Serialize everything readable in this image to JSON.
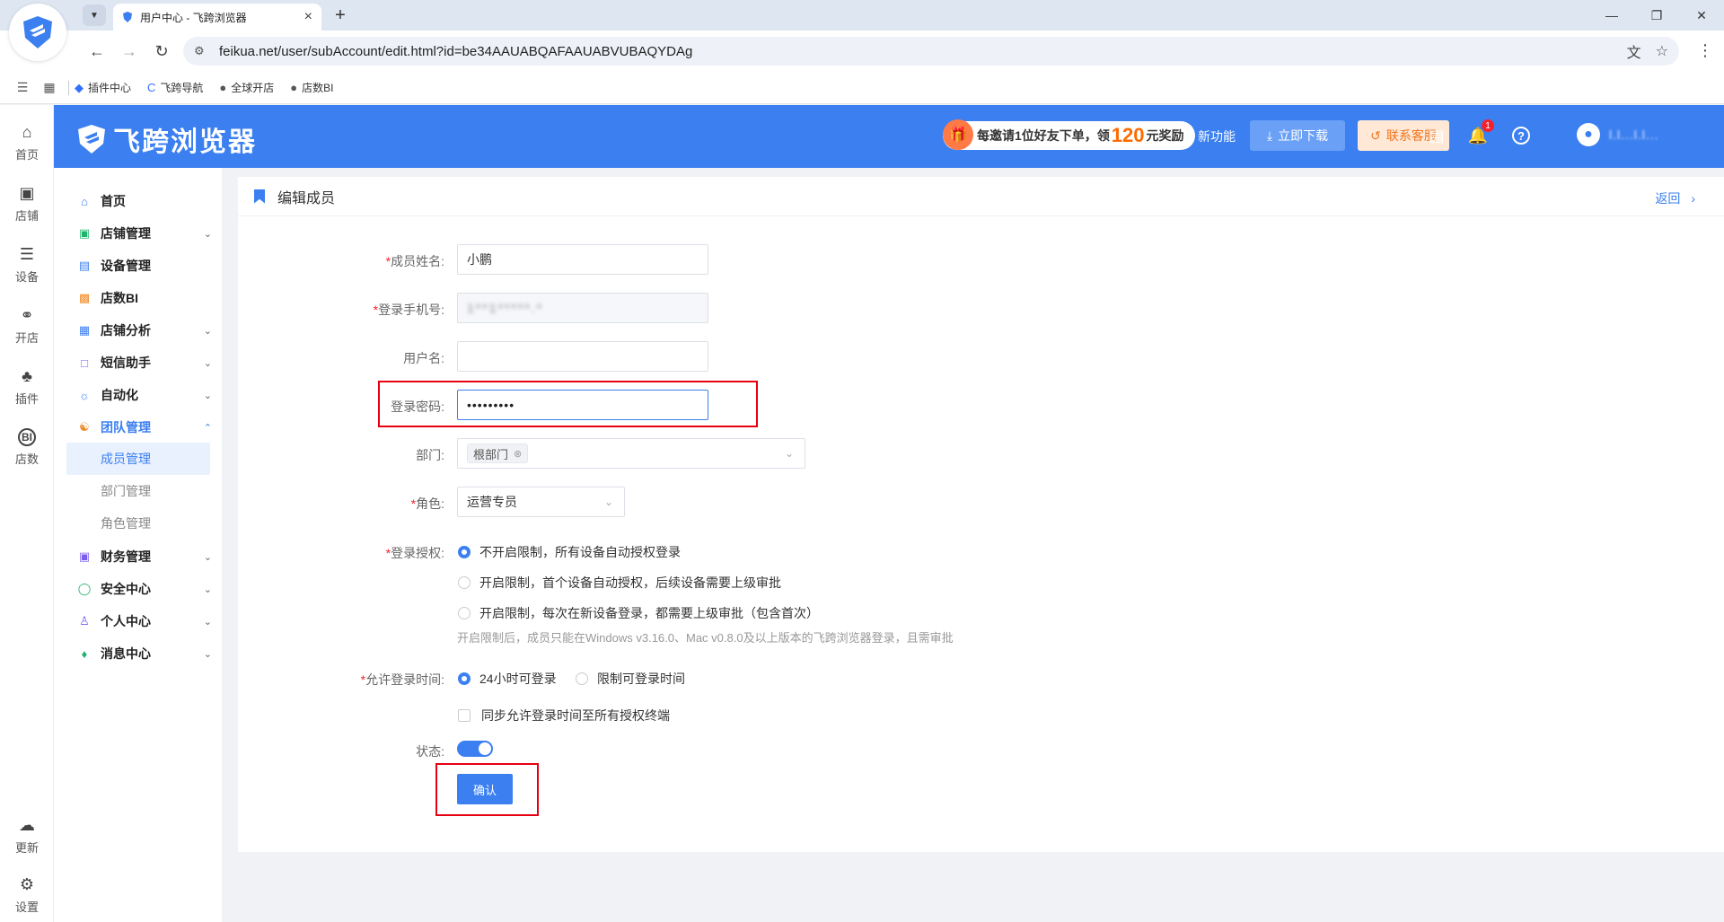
{
  "browser": {
    "tab_title": "用户中心 - 飞跨浏览器",
    "url": "feikua.net/user/subAccount/edit.html?id=be34AAUABQAFAAUABVUBAQYDAg",
    "bookmarks": [
      "插件中心",
      "飞跨导航",
      "全球开店",
      "店数BI"
    ]
  },
  "header": {
    "brand": "飞跨浏览器",
    "promo_prefix": "每邀请1位好友下单，领",
    "promo_amount": "120",
    "promo_suffix": "元奖励",
    "new_feature": "新功能",
    "download": "立即下载",
    "service": "联系客服",
    "notification_count": "1",
    "username": "l.l...l.l..."
  },
  "rail": [
    "首页",
    "店铺",
    "设备",
    "开店",
    "插件",
    "店数",
    "更新",
    "设置"
  ],
  "menu": {
    "items": [
      "首页",
      "店铺管理",
      "设备管理",
      "店数BI",
      "店铺分析",
      "短信助手",
      "自动化",
      "团队管理",
      "财务管理",
      "安全中心",
      "个人中心",
      "消息中心"
    ],
    "team_sub": [
      "成员管理",
      "部门管理",
      "角色管理"
    ]
  },
  "page": {
    "title": "编辑成员",
    "back": "返回"
  },
  "form": {
    "name_label": "成员姓名:",
    "name_value": "小鹏",
    "phone_label": "登录手机号:",
    "phone_value": "1**1*****.*",
    "username_label": "用户名:",
    "username_value": "",
    "password_label": "登录密码:",
    "password_value": "•••••••••",
    "dept_label": "部门:",
    "dept_tag": "根部门",
    "role_label": "角色:",
    "role_value": "运营专员",
    "auth_label": "登录授权:",
    "auth_options": [
      "不开启限制，所有设备自动授权登录",
      "开启限制，首个设备自动授权，后续设备需要上级审批",
      "开启限制，每次在新设备登录，都需要上级审批（包含首次）"
    ],
    "auth_hint": "开启限制后，成员只能在Windows v3.16.0、Mac v0.8.0及以上版本的飞跨浏览器登录，且需审批",
    "time_label": "允许登录时间:",
    "time_options": [
      "24小时可登录",
      "限制可登录时间"
    ],
    "sync_label": "同步允许登录时间至所有授权终端",
    "status_label": "状态:",
    "confirm": "确认"
  }
}
